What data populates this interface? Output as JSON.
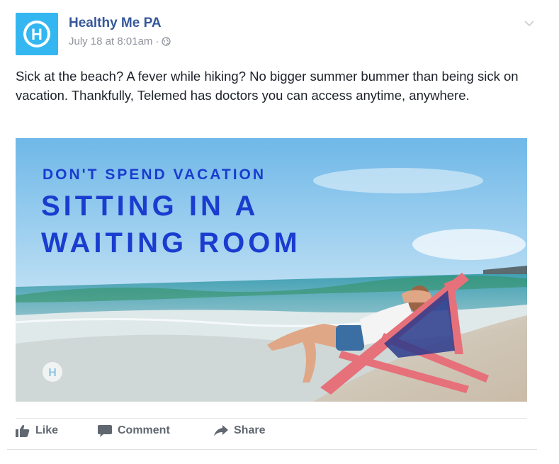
{
  "post": {
    "page_name": "Healthy Me PA",
    "timestamp": "July 18 at 8:01am",
    "separator": "·",
    "privacy_icon": "globe-icon",
    "avatar_letter": "H",
    "menu_icon": "chevron-down-icon",
    "text": "Sick at the beach? A fever while hiking? No bigger summer bummer than being sick on vacation. Thankfully, Telemed has doctors you can access anytime, anywhere."
  },
  "image": {
    "headline_small": "DON'T SPEND VACATION",
    "headline_line1": "SITTING IN A",
    "headline_line2": "WAITING ROOM",
    "watermark_letter": "H",
    "headline_color": "#1a3ccf"
  },
  "actions": {
    "like_label": "Like",
    "comment_label": "Comment",
    "share_label": "Share"
  },
  "colors": {
    "link_blue": "#365899",
    "brand_cyan": "#34b7f1",
    "text_dark": "#1d2129",
    "meta_gray": "#90949c",
    "action_gray": "#606770"
  }
}
